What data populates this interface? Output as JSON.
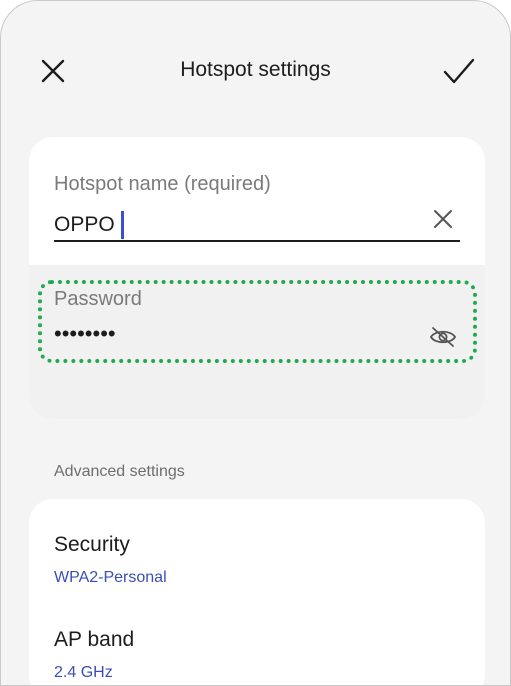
{
  "header": {
    "title": "Hotspot settings",
    "close_icon": "close-icon",
    "confirm_icon": "check-icon"
  },
  "hotspot_name": {
    "label": "Hotspot name (required)",
    "value": "OPPO",
    "clear_icon": "clear-icon"
  },
  "password": {
    "label": "Password",
    "value": "••••••••",
    "visibility_icon": "eye-off-icon"
  },
  "advanced": {
    "section_label": "Advanced settings",
    "items": [
      {
        "title": "Security",
        "value": "WPA2-Personal"
      },
      {
        "title": "AP band",
        "value": "2.4 GHz"
      }
    ]
  },
  "colors": {
    "accent": "#3a4fb5",
    "cursor": "#3b4fcf",
    "highlight": "#1faa50",
    "background": "#f4f4f4"
  }
}
